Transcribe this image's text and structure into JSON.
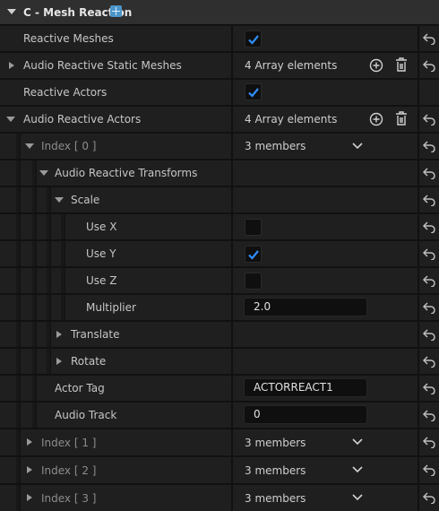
{
  "category": {
    "title": "C - Mesh Reaction"
  },
  "rows": {
    "reactive_meshes": "Reactive Meshes",
    "audio_reactive_static_meshes": "Audio Reactive Static Meshes",
    "static_meshes_count": "4 Array elements",
    "reactive_actors": "Reactive Actors",
    "audio_reactive_actors": "Audio Reactive Actors",
    "actors_count": "4 Array elements",
    "index0": "Index [ 0 ]",
    "index0_members": "3 members",
    "audio_reactive_transforms": "Audio Reactive Transforms",
    "scale": "Scale",
    "use_x": "Use X",
    "use_y": "Use Y",
    "use_z": "Use Z",
    "multiplier": "Multiplier",
    "multiplier_value": "2.0",
    "translate": "Translate",
    "rotate": "Rotate",
    "actor_tag": "Actor Tag",
    "actor_tag_value": "ACTORREACT1",
    "audio_track": "Audio Track",
    "audio_track_value": "0",
    "index1": "Index [ 1 ]",
    "index1_members": "3 members",
    "index2": "Index [ 2 ]",
    "index2_members": "3 members",
    "index3": "Index [ 3 ]",
    "index3_members": "3 members"
  },
  "checkbox_state": {
    "reactive_meshes": true,
    "reactive_actors": true,
    "use_x": false,
    "use_y": true,
    "use_z": false
  },
  "colors": {
    "check": "#2f8fff",
    "badge": "#4b95c9"
  }
}
